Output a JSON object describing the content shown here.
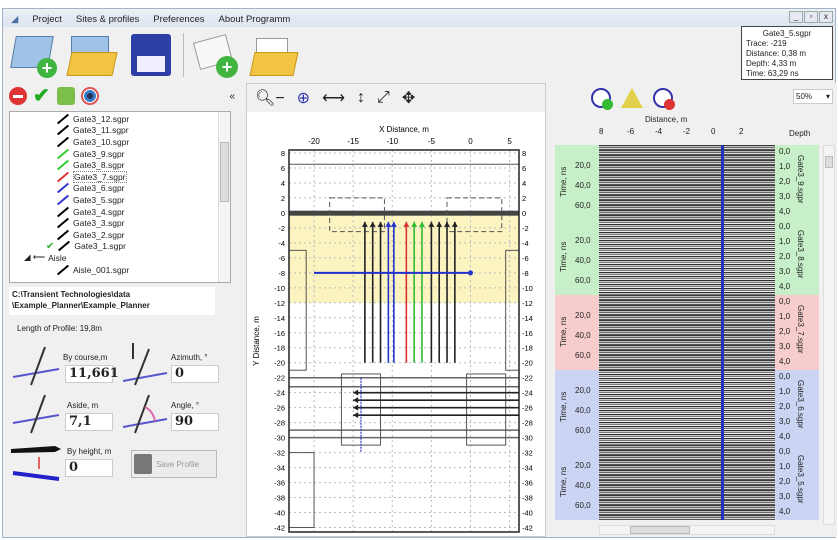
{
  "menu": [
    "Project",
    "Sites & profiles",
    "Preferences",
    "About Programm"
  ],
  "window_buttons": [
    "_",
    "▫",
    "x"
  ],
  "toolbar": [
    "new-site",
    "open-site",
    "save",
    "new-profile",
    "open-profile"
  ],
  "info": {
    "file": "Gate3_5.sgpr",
    "trace": "Trace: -219",
    "distance": "Distance: 0,38 m",
    "depth": "Depth: 4,33 m",
    "time": "Time: 63,29 ns"
  },
  "left": {
    "collapse": "«",
    "tree": [
      {
        "label": "Gate3_12.sgpr",
        "color": "#000"
      },
      {
        "label": "Gate3_11.sgpr",
        "color": "#000"
      },
      {
        "label": "Gate3_10.sgpr",
        "color": "#000"
      },
      {
        "label": "Gate3_9.sgpr",
        "color": "#3c3"
      },
      {
        "label": "Gate3_8.sgpr",
        "color": "#3c3"
      },
      {
        "label": "Gate3_7.sgpr",
        "color": "#d33"
      },
      {
        "label": "Gate3_6.sgpr",
        "color": "#33c"
      },
      {
        "label": "Gate3_5.sgpr",
        "color": "#33c"
      },
      {
        "label": "Gate3_4.sgpr",
        "color": "#000"
      },
      {
        "label": "Gate3_3.sgpr",
        "color": "#000"
      },
      {
        "label": "Gate3_2.sgpr",
        "color": "#000"
      },
      {
        "label": "Gate3_1.sgpr",
        "color": "#000"
      }
    ],
    "group": "Aisle",
    "group_item": "Aisle_001.sgpr",
    "path": "C:\\Transient Technologies\\data \\Example_Planner\\Example_Planner",
    "length": "Length of Profile: 19,8m",
    "by_course_label": "By course,m",
    "by_course": "11,661",
    "azimuth_label": "Azimuth, °",
    "azimuth": "0",
    "aside_label": "Aside, m",
    "aside": "7,1",
    "angle_label": "Angle, °",
    "angle": "90",
    "height_label": "By height, m",
    "height": "0",
    "save_profile": "Save Profile"
  },
  "plan": {
    "xlabel": "X Distance, m",
    "ylabel": "Y Distance, m",
    "xticks": [
      "-20",
      "-15",
      "-10",
      "-5",
      "0",
      "5"
    ],
    "yticks": [
      "8",
      "6",
      "4",
      "2",
      "0",
      "-2",
      "-4",
      "-6",
      "-8",
      "-10",
      "-12",
      "-14",
      "-16",
      "-18",
      "-20",
      "-22",
      "-24",
      "-26",
      "-28",
      "-30",
      "-32",
      "-34",
      "-36",
      "-38",
      "-40",
      "-42"
    ],
    "xlim": [
      -23.2,
      6.2
    ],
    "ylim": [
      -42.6,
      8.4
    ],
    "highlight_y": [
      -12,
      0
    ],
    "profiles_vertical": [
      {
        "x": -13.5,
        "color": "#222"
      },
      {
        "x": -12.5,
        "color": "#222"
      },
      {
        "x": -11.5,
        "color": "#222"
      },
      {
        "x": -10.5,
        "color": "#2233cc"
      },
      {
        "x": -9.8,
        "color": "#2233cc"
      },
      {
        "x": -8.2,
        "color": "#dd3333"
      },
      {
        "x": -7.2,
        "color": "#33bb33"
      },
      {
        "x": -6.2,
        "color": "#33bb33"
      },
      {
        "x": -5,
        "color": "#222"
      },
      {
        "x": -4,
        "color": "#222"
      },
      {
        "x": -3,
        "color": "#222"
      },
      {
        "x": -2,
        "color": "#222"
      }
    ],
    "profiles_horizontal": [
      {
        "y": -24,
        "color": "#222"
      },
      {
        "y": -25,
        "color": "#222"
      },
      {
        "y": -26,
        "color": "#222"
      },
      {
        "y": -27,
        "color": "#222"
      }
    ],
    "selected_line": {
      "y": -8,
      "color": "#2233cc"
    }
  },
  "radar": {
    "zoom": "50%",
    "xlabel": "Distance, m",
    "xticks": [
      "8",
      "-6",
      "-4",
      "-2",
      "0",
      "2"
    ],
    "depth_label": "Depth",
    "time_label": "Time, ns",
    "time_ticks": [
      "20,0",
      "40,0",
      "60,0"
    ],
    "depth_ticks": [
      "0,0",
      "1,0",
      "2,0",
      "3,0",
      "4,0"
    ],
    "strips": [
      {
        "name": "Gate3_9.sgpr",
        "color": "#c8f0c8"
      },
      {
        "name": "Gate3_8.sgpr",
        "color": "#c8f0c8"
      },
      {
        "name": "Gate3_7.sgpr",
        "color": "#f6cccc"
      },
      {
        "name": "Gate3_6.sgpr",
        "color": "#ccd4f4"
      },
      {
        "name": "Gate3_5.sgpr",
        "color": "#ccd4f4"
      }
    ]
  }
}
